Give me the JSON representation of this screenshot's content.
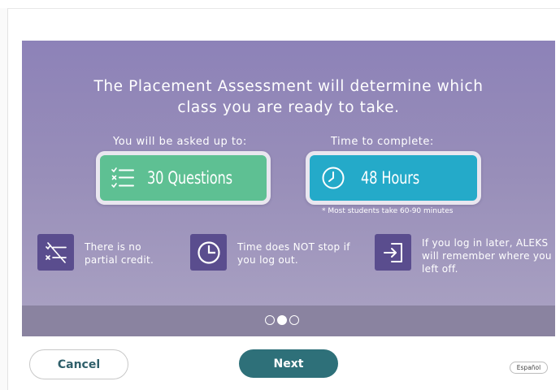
{
  "assessment": {
    "headline": "The Placement Assessment will determine which class you are ready to take.",
    "questions_label": "You will be asked up to:",
    "time_label": "Time to complete:",
    "questions_value": "30 Questions",
    "questions_icon": "checklist-icon",
    "hours_value": "48 Hours",
    "hours_icon": "clock-icon",
    "footnote": "* Most students take 60-90 minutes"
  },
  "features": [
    {
      "icon": "no-partial-credit-icon",
      "text": "There is no partial credit."
    },
    {
      "icon": "timer-icon",
      "text": "Time does NOT stop if you log out."
    },
    {
      "icon": "login-icon",
      "text": "If you log in later, ALEKS will remember where you left off."
    }
  ],
  "pager": {
    "current": 2,
    "total": 3
  },
  "buttons": {
    "cancel": "Cancel",
    "next": "Next",
    "language": "Español"
  },
  "colors": {
    "panel": "#8d82b8",
    "questions_card": "#5ec093",
    "hours_card": "#24aac9",
    "feature_icon_bg": "#5a4d8e",
    "next_button": "#2e7079"
  }
}
